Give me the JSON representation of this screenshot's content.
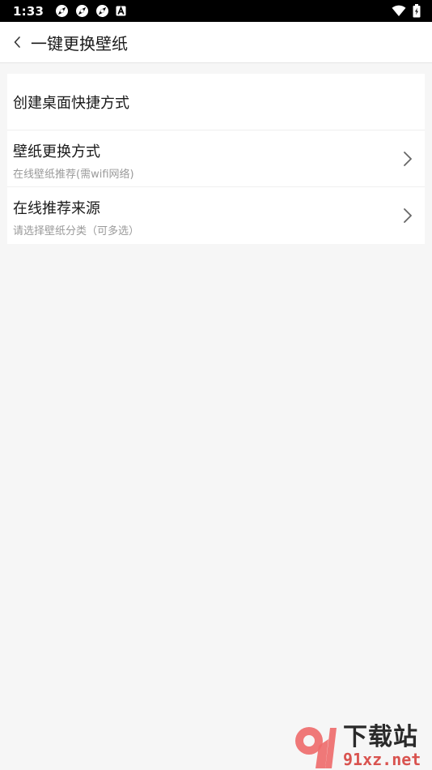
{
  "status_bar": {
    "time": "1:33",
    "icons": [
      "photo-icon",
      "photo-icon",
      "photo-icon",
      "a-badge-icon"
    ],
    "right_icons": [
      "wifi-icon",
      "battery-icon"
    ]
  },
  "app_bar": {
    "back_icon": "chevron-left-icon",
    "title": "一键更换壁纸"
  },
  "settings": {
    "items": [
      {
        "title": "创建桌面快捷方式"
      },
      {
        "title": "壁纸更换方式",
        "subtitle": "在线壁纸推荐(需wifi网络)"
      },
      {
        "title": "在线推荐来源",
        "subtitle": "请选择壁纸分类（可多选）"
      }
    ]
  },
  "watermark": {
    "logo_text": "91",
    "big_text": "下载站",
    "url": "91xz.net",
    "accent": "#d9534f"
  }
}
